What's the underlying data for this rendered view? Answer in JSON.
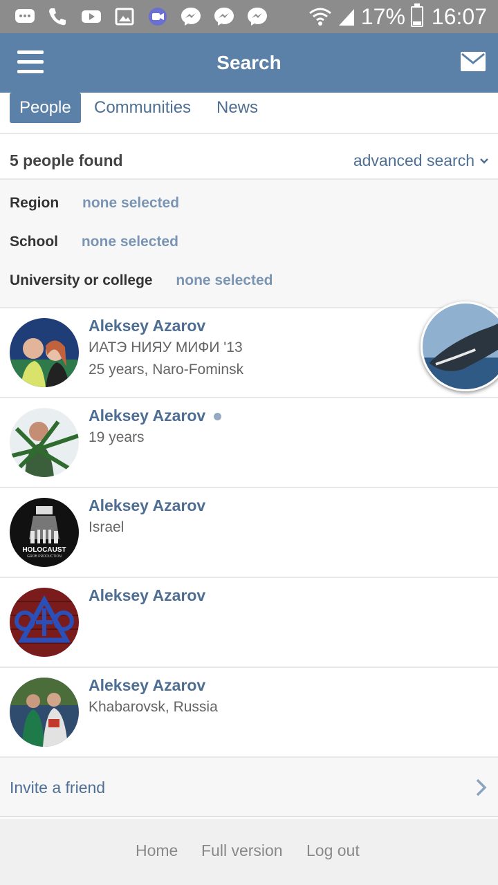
{
  "status_bar": {
    "notification_icons": [
      "chat-bubble-icon",
      "phone-icon",
      "youtube-icon",
      "gallery-icon",
      "video-call-icon",
      "messenger-icon",
      "messenger-icon",
      "messenger-icon"
    ],
    "battery": "17%",
    "time": "16:07"
  },
  "header": {
    "title": "Search"
  },
  "tabs": [
    {
      "label": "People",
      "active": true
    },
    {
      "label": "Communities",
      "active": false
    },
    {
      "label": "News",
      "active": false
    }
  ],
  "results": {
    "count_text": "5 people found",
    "advanced_label": "advanced search"
  },
  "filters": {
    "region_label": "Region",
    "region_value": "none selected",
    "school_label": "School",
    "school_value": "none selected",
    "university_label": "University or college",
    "university_value": "none selected"
  },
  "people": [
    {
      "name": "Aleksey Azarov",
      "line1": "ИАТЭ НИЯУ МИФИ '13",
      "line2": "25 years, Naro-Fominsk",
      "online": false
    },
    {
      "name": "Aleksey Azarov",
      "line1": "19 years",
      "line2": "",
      "online": true
    },
    {
      "name": "Aleksey Azarov",
      "line1": "Israel",
      "line2": "",
      "online": false,
      "avatar_text_1": "HOLOCAUST",
      "avatar_text_2": "GROB PRODUCTION"
    },
    {
      "name": "Aleksey Azarov",
      "line1": "",
      "line2": "",
      "online": false
    },
    {
      "name": "Aleksey Azarov",
      "line1": "Khabarovsk, Russia",
      "line2": "",
      "online": false
    }
  ],
  "invite": {
    "label": "Invite a friend"
  },
  "footer": {
    "home": "Home",
    "full_version": "Full version",
    "log_out": "Log out"
  },
  "colors": {
    "header_bg": "#5b81a8",
    "link": "#4e6f93",
    "status_bar_bg": "#8c8c8c"
  }
}
